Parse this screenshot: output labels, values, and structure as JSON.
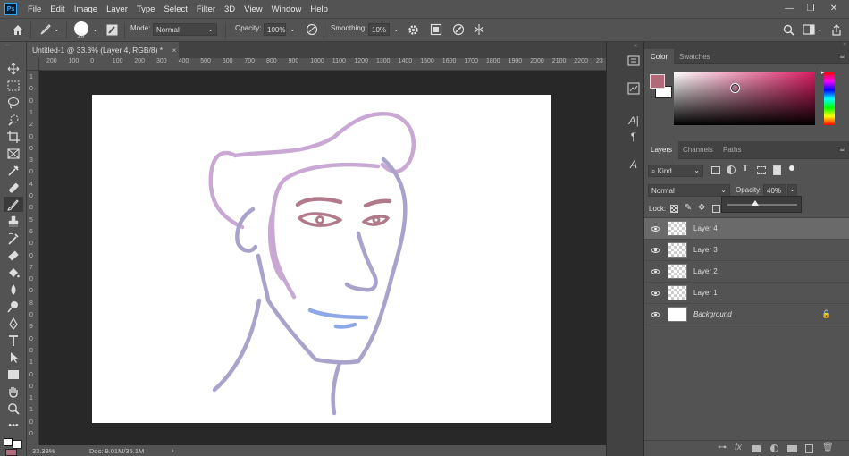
{
  "menu": {
    "logo": "Ps",
    "items": [
      "File",
      "Edit",
      "Image",
      "Layer",
      "Type",
      "Select",
      "Filter",
      "3D",
      "View",
      "Window",
      "Help"
    ]
  },
  "window_controls": [
    "—",
    "❐",
    "✕"
  ],
  "options": {
    "brush_size": "20",
    "mode_label": "Mode:",
    "mode_value": "Normal",
    "opacity_label": "Opacity:",
    "opacity_value": "100%",
    "smoothing_label": "Smoothing:",
    "smoothing_value": "10%"
  },
  "document": {
    "tab_title": "Untitled-1 @ 33.3% (Layer 4, RGB/8) *",
    "tab_close": "×",
    "ruler_top": [
      "200",
      "100",
      "0",
      "100",
      "200",
      "300",
      "400",
      "500",
      "600",
      "700",
      "800",
      "900",
      "1000",
      "1100",
      "1200",
      "1300",
      "1400",
      "1500",
      "1600",
      "1700",
      "1800",
      "1900",
      "2000",
      "2100",
      "2200",
      "23"
    ],
    "ruler_left": [
      "1",
      "0",
      "0",
      "1",
      "2",
      "0",
      "0",
      "3",
      "0",
      "4",
      "0",
      "0",
      "5",
      "6",
      "0",
      "0",
      "7",
      "0",
      "0",
      "8",
      "0",
      "9",
      "0",
      "0",
      "1",
      "0",
      "0",
      "1",
      "1",
      "0",
      "0"
    ]
  },
  "status": {
    "zoom": "33.33%",
    "doc_info": "Doc: 9.01M/35.1M",
    "arrow": "›"
  },
  "colors": {
    "foreground": "#b06a7a",
    "background": "#ffffff",
    "hue_marker": "#d81b60",
    "stroke_main": "#a9a3cc",
    "stroke_hair": "#c9a9d4",
    "stroke_eyes": "#b07a8a",
    "stroke_mouth": "#8fa8e8"
  },
  "panels": {
    "top_tabs": [
      "Color",
      "Swatches"
    ],
    "layer_tabs": [
      "Layers",
      "Channels",
      "Paths"
    ],
    "kind_label": "Kind",
    "blend_mode": "Normal",
    "opacity_label": "Opacity:",
    "opacity_value": "40%",
    "lock_label": "Lock:",
    "opacity_slider_fraction": 0.4
  },
  "layers": [
    {
      "name": "Layer 4",
      "selected": true
    },
    {
      "name": "Layer 3",
      "selected": false
    },
    {
      "name": "Layer 2",
      "selected": false
    },
    {
      "name": "Layer 1",
      "selected": false
    },
    {
      "name": "Background",
      "selected": false,
      "locked": true
    }
  ],
  "tools": [
    "move",
    "marquee",
    "lasso",
    "quick-select",
    "crop",
    "frame",
    "eyedropper",
    "healing",
    "brush",
    "clone-stamp",
    "history-brush",
    "eraser",
    "paint-bucket",
    "blur",
    "dodge",
    "pen",
    "type",
    "path-select",
    "rectangle",
    "hand",
    "zoom",
    "more"
  ]
}
